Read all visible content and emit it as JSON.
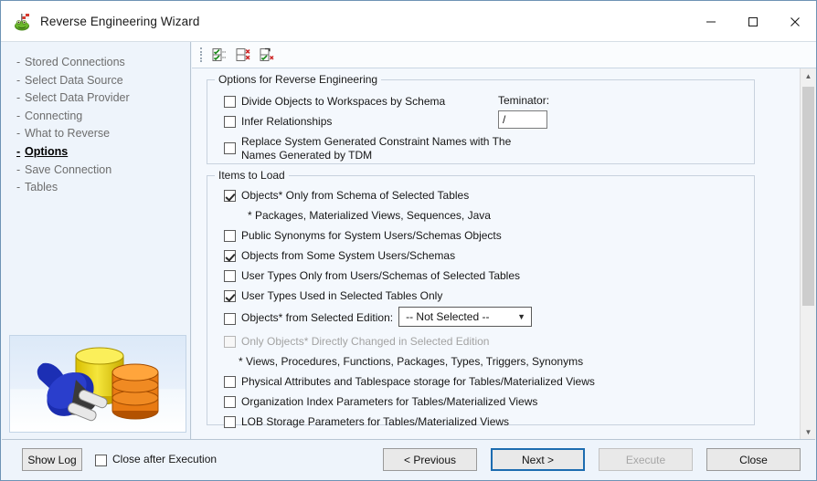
{
  "window": {
    "title": "Reverse Engineering Wizard",
    "app_icon": "toad-frog-icon",
    "controls": {
      "minimize": "minimize-icon",
      "maximize": "maximize-icon",
      "close": "close-icon"
    }
  },
  "sidebar": {
    "items": [
      {
        "label": "Stored Connections",
        "active": false
      },
      {
        "label": "Select Data Source",
        "active": false
      },
      {
        "label": "Select Data Provider",
        "active": false
      },
      {
        "label": "Connecting",
        "active": false
      },
      {
        "label": "What to Reverse",
        "active": false
      },
      {
        "label": "Options",
        "active": true
      },
      {
        "label": "Save Connection",
        "active": false
      },
      {
        "label": "Tables",
        "active": false
      }
    ],
    "dash": "-",
    "artwork": "database-plug-illustration"
  },
  "toolbar": {
    "buttons": [
      {
        "name": "check-all-icon",
        "tooltip": "Check All"
      },
      {
        "name": "uncheck-all-icon",
        "tooltip": "Uncheck All"
      },
      {
        "name": "invert-selection-icon",
        "tooltip": "Invert Selection"
      }
    ]
  },
  "options_group": {
    "legend": "Options for Reverse Engineering",
    "checkboxes": [
      {
        "label": "Divide Objects to Workspaces by Schema",
        "checked": false,
        "disabled": false
      },
      {
        "label": "Infer Relationships",
        "checked": false,
        "disabled": false
      },
      {
        "label": "Replace System Generated Constraint Names with The Names Generated by TDM",
        "checked": false,
        "disabled": false,
        "wrap": true
      }
    ],
    "terminator": {
      "label": "Teminator:",
      "value": "/",
      "placeholder": ""
    }
  },
  "items_group": {
    "legend": "Items to Load",
    "checkboxes": [
      {
        "label": "Objects* Only from Schema of Selected Tables",
        "checked": true,
        "disabled": false
      },
      {
        "label": "Public Synonyms for System Users/Schemas Objects",
        "checked": false,
        "disabled": false
      },
      {
        "label": "Objects from Some System Users/Schemas",
        "checked": true,
        "disabled": false
      },
      {
        "label": "User Types Only from Users/Schemas of Selected Tables",
        "checked": false,
        "disabled": false
      },
      {
        "label": "User Types Used in Selected Tables Only",
        "checked": true,
        "disabled": false
      },
      {
        "label": "Objects* from Selected Edition:",
        "checked": false,
        "disabled": false
      },
      {
        "label": "Only Objects* Directly Changed in Selected Edition",
        "checked": false,
        "disabled": true
      },
      {
        "label": "Physical Attributes and Tablespace storage for Tables/Materialized Views",
        "checked": false,
        "disabled": false
      },
      {
        "label": "Organization Index Parameters for Tables/Materialized Views",
        "checked": false,
        "disabled": false
      },
      {
        "label": "LOB Storage Parameters for Tables/Materialized Views",
        "checked": false,
        "disabled": false
      }
    ],
    "note_objects": "* Packages, Materialized Views, Sequences, Java",
    "note_views": "* Views, Procedures, Functions, Packages, Types, Triggers, Synonyms",
    "edition_dropdown": {
      "value": "-- Not Selected --",
      "options": [
        "-- Not Selected --"
      ]
    }
  },
  "footer": {
    "show_log": "Show Log",
    "close_after_execution": {
      "label": "Close after Execution",
      "checked": false
    },
    "previous": "< Previous",
    "next": "Next >",
    "execute": "Execute",
    "close": "Close"
  },
  "colors": {
    "accent": "#1c6cb0",
    "panel_bg": "#f4f8fd",
    "sidebar_bg": "#eef4fb",
    "border": "#c8d2de",
    "disabled_text": "#a3a3a3",
    "nav_text": "#6d6d6d"
  },
  "scrollbar": {
    "position_percent": 0
  }
}
